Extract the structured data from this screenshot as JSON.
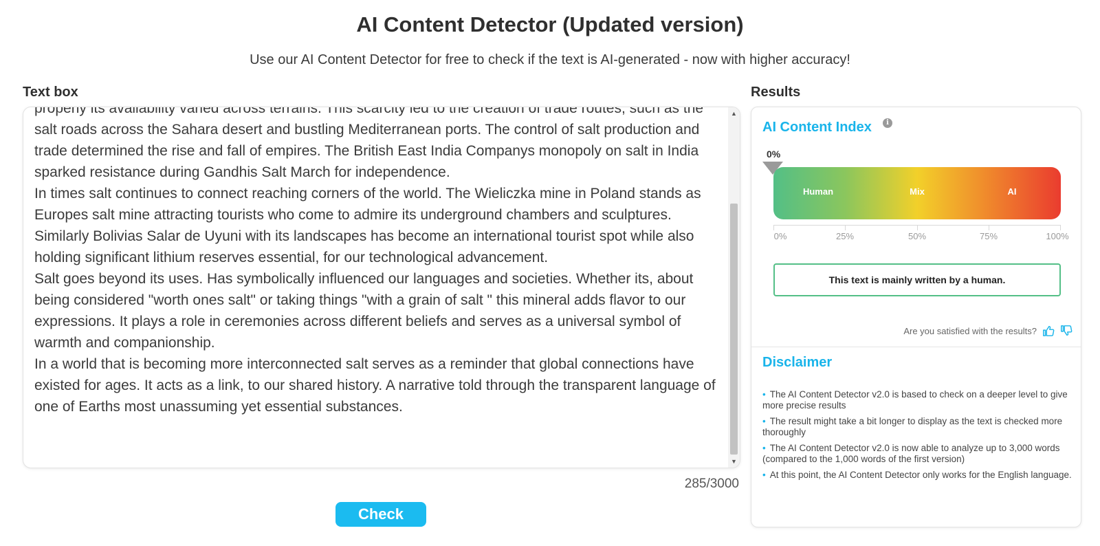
{
  "header": {
    "title": "AI Content Detector (Updated version)",
    "subtitle": "Use our AI Content Detector for free to check if the text is AI-generated - now with higher accuracy!"
  },
  "textbox": {
    "label": "Text box",
    "paragraphs": [
      "properly its availability varied across terrains. This scarcity led to the creation of trade routes, such as the salt roads across the Sahara desert and bustling Mediterranean ports. The control of salt production and trade determined the rise and fall of empires. The British East India Companys monopoly on salt in India sparked resistance during Gandhis Salt March for independence.",
      "In times salt continues to connect reaching corners of the world. The Wieliczka mine in Poland stands as Europes salt mine attracting tourists who come to admire its underground chambers and sculptures. Similarly Bolivias Salar de Uyuni with its landscapes has become an international tourist spot while also holding significant lithium reserves essential, for our technological advancement.",
      "Salt goes beyond its uses. Has symbolically influenced our languages and societies. Whether its, about being considered \"worth ones salt\" or taking things \"with a grain of salt \" this mineral adds flavor to our expressions. It plays a role in ceremonies across different beliefs and serves as a universal symbol of warmth and companionship.",
      "In a world that is becoming more interconnected salt serves as a reminder that global connections have existed for ages. It acts as a link, to our shared history. A narrative told through the transparent language of one of Earths most unassuming yet essential substances."
    ],
    "word_count": "285/3000",
    "check_label": "Check"
  },
  "results": {
    "label": "Results",
    "index_title": "AI Content Index",
    "info_icon": "info-icon",
    "score_label": "0%",
    "score_value": 0,
    "gauge": {
      "human": "Human",
      "mix": "Mix",
      "ai": "AI"
    },
    "scale": [
      "0%",
      "25%",
      "50%",
      "75%",
      "100%"
    ],
    "verdict": "This text is mainly written by a human.",
    "feedback_question": "Are you satisfied with the results?",
    "colors": {
      "accent": "#19b4ea",
      "human": "#53bf86",
      "mix": "#f2d02a",
      "ai": "#ea3c2f"
    }
  },
  "disclaimer": {
    "title": "Disclaimer",
    "items": [
      "The AI Content Detector v2.0 is based to check on a deeper level to give more precise results",
      "The result might take a bit longer to display as the text is checked more thoroughly",
      "The AI Content Detector v2.0 is now able to analyze up to 3,000 words (compared to the 1,000 words of the first version)",
      "At this point, the AI Content Detector only works for the English language."
    ]
  }
}
